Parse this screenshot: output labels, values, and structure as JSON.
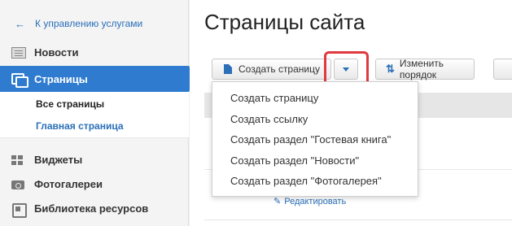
{
  "sidebar": {
    "back_label": "К управлению услугами",
    "items": [
      {
        "label": "Новости"
      },
      {
        "label": "Страницы"
      },
      {
        "label": "Виджеты"
      },
      {
        "label": "Фотогалереи"
      },
      {
        "label": "Библиотека ресурсов"
      }
    ],
    "subitems": [
      {
        "label": "Все страницы"
      },
      {
        "label": "Главная страница"
      }
    ]
  },
  "main": {
    "title": "Страницы сайта",
    "toolbar": {
      "create_label": "Создать страницу",
      "reorder_label": "Изменить порядок"
    },
    "edit_label": "Редактировать"
  },
  "dropdown": {
    "items": [
      "Создать страницу",
      "Создать ссылку",
      "Создать раздел \"Гостевая книга\"",
      "Создать раздел \"Новости\"",
      "Создать раздел \"Фотогалерея\""
    ]
  },
  "colors": {
    "accent": "#2f7bd0",
    "link": "#2a6fb8",
    "highlight": "#e0393e"
  }
}
